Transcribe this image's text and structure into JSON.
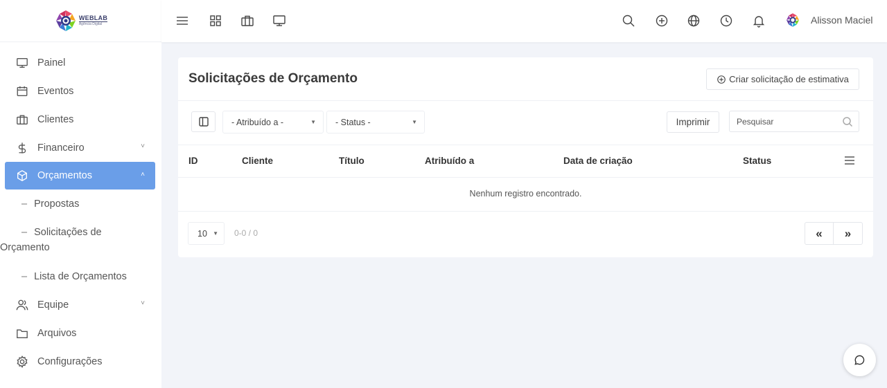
{
  "brand": {
    "name": "WEBLAB",
    "tagline": "Agência Digital"
  },
  "sidebar": {
    "items": [
      {
        "label": "Painel",
        "icon": "monitor-icon"
      },
      {
        "label": "Eventos",
        "icon": "calendar-icon"
      },
      {
        "label": "Clientes",
        "icon": "briefcase-icon"
      },
      {
        "label": "Financeiro",
        "icon": "dollar-icon",
        "expand": "˅"
      },
      {
        "label": "Orçamentos",
        "icon": "box-icon",
        "expand": "˄",
        "active": true
      },
      {
        "label": "Propostas",
        "sub": true
      },
      {
        "label": "Solicitações de Orçamento",
        "sub": true
      },
      {
        "label": "Lista de Orçamentos",
        "sub": true
      },
      {
        "label": "Equipe",
        "icon": "users-icon",
        "expand": "˅"
      },
      {
        "label": "Arquivos",
        "icon": "folder-icon"
      },
      {
        "label": "Configurações",
        "icon": "settings-icon"
      }
    ],
    "sub_dash": "–",
    "sub_line1": "Solicitações de",
    "sub_line2": "Orçamento"
  },
  "topbar": {
    "user_name": "Alisson Maciel",
    "left_icons": [
      "menu-icon",
      "grid-icon",
      "briefcase-icon",
      "monitor-icon"
    ],
    "right_icons": [
      "search-icon",
      "plus-circle-icon",
      "globe-icon",
      "clock-icon",
      "bell-icon"
    ]
  },
  "card": {
    "title": "Solicitações de Orçamento",
    "create_button": "Criar solicitação de estimativa",
    "filter_assigned": "- Atribuído a -",
    "filter_status": "- Status -",
    "print_button": "Imprimir",
    "search_placeholder": "Pesquisar",
    "columns": [
      "ID",
      "Cliente",
      "Título",
      "Atribuído a",
      "Data de criação",
      "Status"
    ],
    "empty_message": "Nenhum registro encontrado.",
    "page_size": "10",
    "page_info": "0-0 / 0",
    "prev": "«",
    "next": "»"
  },
  "colors": {
    "accent": "#6a9ee8",
    "background": "#f2f4f9"
  }
}
